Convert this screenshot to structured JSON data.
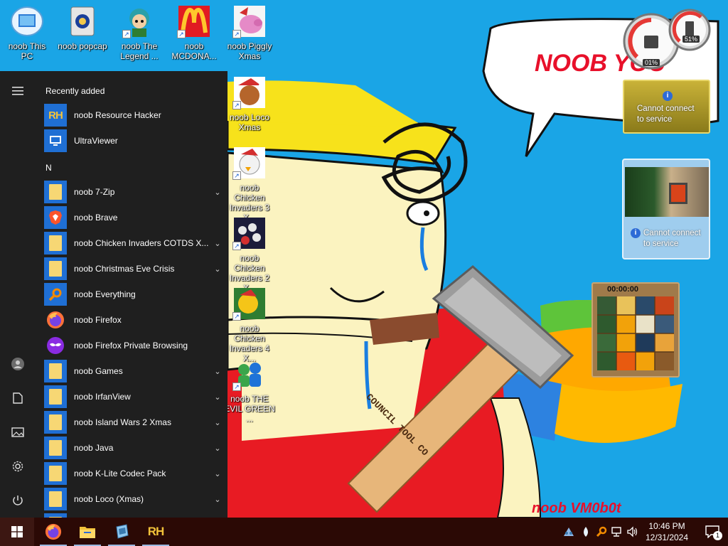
{
  "desktop": {
    "icons": [
      {
        "label": "noob This PC"
      },
      {
        "label": "noob popcap"
      },
      {
        "label": "noob The Legend ..."
      },
      {
        "label": "noob MCDONA..."
      },
      {
        "label": "noob Piggly Xmas"
      },
      {
        "label": "noob Loco Xmas"
      },
      {
        "label": "noob Chicken Invaders 3 X..."
      },
      {
        "label": "noob Chicken Invaders 2 X..."
      },
      {
        "label": "noob Chicken Invaders 4 X..."
      },
      {
        "label": "noob THE EVIL GREEN ..."
      }
    ],
    "wallpaper_text": {
      "bubble": "NOOB YOU",
      "signature": "noob VM0b0t",
      "hammer_handle": "COUNCIL TOOL CO"
    }
  },
  "start_menu": {
    "recently_added_header": "Recently added",
    "recent": [
      {
        "label": "noob Resource Hacker",
        "icon": "resource-hacker-icon"
      },
      {
        "label": "UltraViewer",
        "icon": "ultraviewer-icon"
      }
    ],
    "group_letter": "N",
    "apps": [
      {
        "label": "noob 7-Zip",
        "icon": "folder-icon",
        "expandable": true
      },
      {
        "label": "noob Brave",
        "icon": "brave-icon",
        "expandable": false
      },
      {
        "label": "noob Chicken Invaders COTDS X...",
        "icon": "folder-icon",
        "expandable": true
      },
      {
        "label": "noob Christmas Eve Crisis",
        "icon": "folder-icon",
        "expandable": true
      },
      {
        "label": "noob Everything",
        "icon": "everything-search-icon",
        "expandable": false
      },
      {
        "label": "noob Firefox",
        "icon": "firefox-icon",
        "expandable": false
      },
      {
        "label": "noob Firefox Private Browsing",
        "icon": "firefox-private-icon",
        "expandable": false
      },
      {
        "label": "noob Games",
        "icon": "folder-icon",
        "expandable": true
      },
      {
        "label": "noob IrfanView",
        "icon": "folder-icon",
        "expandable": true
      },
      {
        "label": "noob Island Wars 2 Xmas",
        "icon": "folder-icon",
        "expandable": true
      },
      {
        "label": "noob Java",
        "icon": "folder-icon",
        "expandable": true
      },
      {
        "label": "noob K-Lite Codec Pack",
        "icon": "folder-icon",
        "expandable": true
      },
      {
        "label": "noob Loco (Xmas)",
        "icon": "folder-icon",
        "expandable": true
      }
    ],
    "rail": [
      "hamburger-menu-icon",
      "user-icon",
      "documents-icon",
      "pictures-icon",
      "settings-icon",
      "power-icon"
    ]
  },
  "taskbar": {
    "pinned": [
      "windows-start-icon",
      "firefox-icon",
      "file-explorer-icon",
      "ultraviewer-icon",
      "resource-hacker-icon"
    ],
    "clock": {
      "time": "10:46 PM",
      "date": "12/31/2024"
    },
    "notification_count": "1"
  },
  "gadgets": {
    "cpu_meter": {
      "cpu": "01%",
      "memory": "51%"
    },
    "weather": {
      "message": "Cannot connect to service"
    },
    "slideshow": {
      "message": "Cannot connect to service"
    },
    "puzzle": {
      "timer": "00:00:00"
    }
  },
  "colors": {
    "start_bg": "#1f1f1f",
    "taskbar_bg": "#2b0905",
    "accent": "#1f6fd4",
    "wallpaper": "#1aa5e6"
  }
}
